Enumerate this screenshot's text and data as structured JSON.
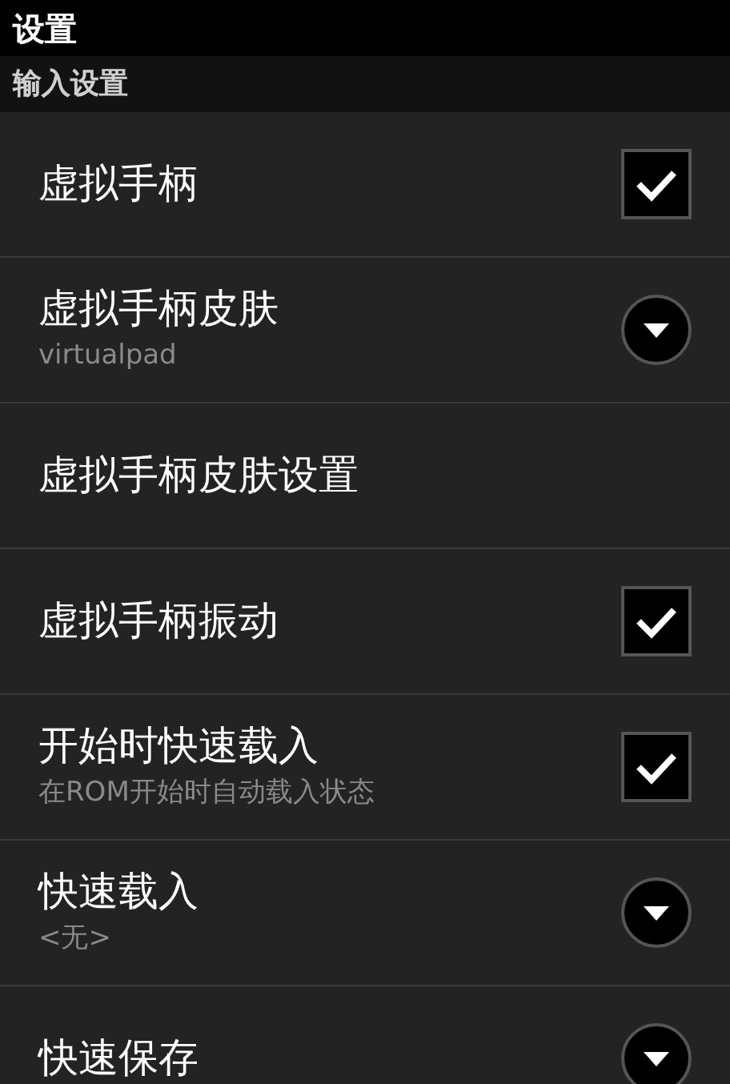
{
  "title": "设置",
  "section": "输入设置",
  "items": [
    {
      "kind": "checkbox",
      "label": "虚拟手柄",
      "checked": true
    },
    {
      "kind": "dropdown",
      "label": "虚拟手柄皮肤",
      "summary": "virtualpad"
    },
    {
      "kind": "plain",
      "label": "虚拟手柄皮肤设置"
    },
    {
      "kind": "checkbox",
      "label": "虚拟手柄振动",
      "checked": true
    },
    {
      "kind": "checkbox",
      "label": "开始时快速载入",
      "summary": "在ROM开始时自动载入状态",
      "checked": true
    },
    {
      "kind": "dropdown",
      "label": "快速载入",
      "summary": "<无>"
    },
    {
      "kind": "dropdown",
      "label": "快速保存"
    }
  ]
}
